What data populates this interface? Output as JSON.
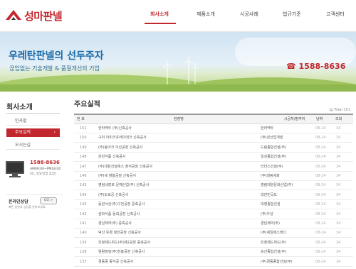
{
  "brand": {
    "name": "성마판넬",
    "accent": "#c1272d"
  },
  "nav": {
    "items": [
      {
        "label": "회사소개",
        "active": true
      },
      {
        "label": "제품소개",
        "active": false
      },
      {
        "label": "시공사례",
        "active": false
      },
      {
        "label": "법규기준",
        "active": false
      },
      {
        "label": "고객센터",
        "active": false
      }
    ]
  },
  "banner": {
    "slogan": "우레탄판넬의 선두주자",
    "sub": "끊임없는 기술개발 & 품질개선의 기업",
    "phone": "1588-8636",
    "phone_icon": "phone-icon"
  },
  "sidebar": {
    "title": "회사소개",
    "items": [
      {
        "label": "인사말",
        "active": false
      },
      {
        "label": "주요실적",
        "active": true
      },
      {
        "label": "오시는길",
        "active": false
      }
    ],
    "contact": {
      "phone": "1588-8636",
      "hours": "AM09:00~PM18:00",
      "note": "(토, 일요일및 휴일)"
    },
    "online": {
      "title": "온라인상담",
      "go": "GO >",
      "desc": "빠른 답변과 상담을 받아보세요."
    }
  },
  "main": {
    "title": "주요실적",
    "total": "Total 151",
    "columns": [
      "번 호",
      "현장명",
      "시공자/발주처",
      "날짜",
      "조회"
    ],
    "rows": [
      {
        "num": "151",
        "title": "한라백두 (주)신축공사",
        "client": "한라백두",
        "date": "08-24",
        "hits": "34"
      },
      {
        "num": "150",
        "title": "구미 아미크프레이데크 신축공사",
        "client": "(주)성산업개발",
        "date": "08-24",
        "hits": "34"
      },
      {
        "num": "149",
        "title": "(주)동아크 의산공장 신축공사",
        "client": "드림종합건설(주)",
        "date": "08-24",
        "hits": "34"
      },
      {
        "num": "148",
        "title": "은빈식품 신축공사",
        "client": "일성종합건설(주)",
        "date": "08-24",
        "hits": "34"
      },
      {
        "num": "147",
        "title": "(주)대원건설에스 창석공장 신축공사",
        "client": "리더스건설(주)",
        "date": "08-24",
        "hits": "34"
      },
      {
        "num": "146",
        "title": "(주)세 향흥공장 신축공사",
        "client": "(주)대림세화",
        "date": "08-24",
        "hits": "34"
      },
      {
        "num": "145",
        "title": "영림내장로 문예산업(주) 신축공사",
        "client": "영림대양문화산업(주)",
        "date": "08-24",
        "hits": "34"
      },
      {
        "num": "144",
        "title": "(주)도로공 신축공사",
        "client": "대한민국도",
        "date": "08-24",
        "hits": "34"
      },
      {
        "num": "143",
        "title": "동원서산(주)구전공장 증축공사",
        "client": "대영종합건설",
        "date": "08-24",
        "hits": "34"
      },
      {
        "num": "142",
        "title": "삼화식품 동희공장 신축공사",
        "client": "(주)우성",
        "date": "08-24",
        "hits": "34"
      },
      {
        "num": "141",
        "title": "경남제약(주) 증축공사",
        "client": "경남제약(주)",
        "date": "08-24",
        "hits": "34"
      },
      {
        "num": "140",
        "title": "덕산 유경 정안공장 신축공사",
        "client": "(주)세일에스엔디",
        "date": "08-24",
        "hits": "34"
      },
      {
        "num": "139",
        "title": "진청제드위드(주)제2공장 증축공사",
        "client": "진청제드위드(주)",
        "date": "08-24",
        "hits": "34"
      },
      {
        "num": "138",
        "title": "염람정밀(주)천흥공장 신축공사",
        "client": "승산종합건설(주)",
        "date": "08-24",
        "hits": "34"
      },
      {
        "num": "137",
        "title": "경동중 동식공 신축공사",
        "client": "(주)경동종합건설(주)",
        "date": "08-24",
        "hits": "34"
      }
    ]
  }
}
